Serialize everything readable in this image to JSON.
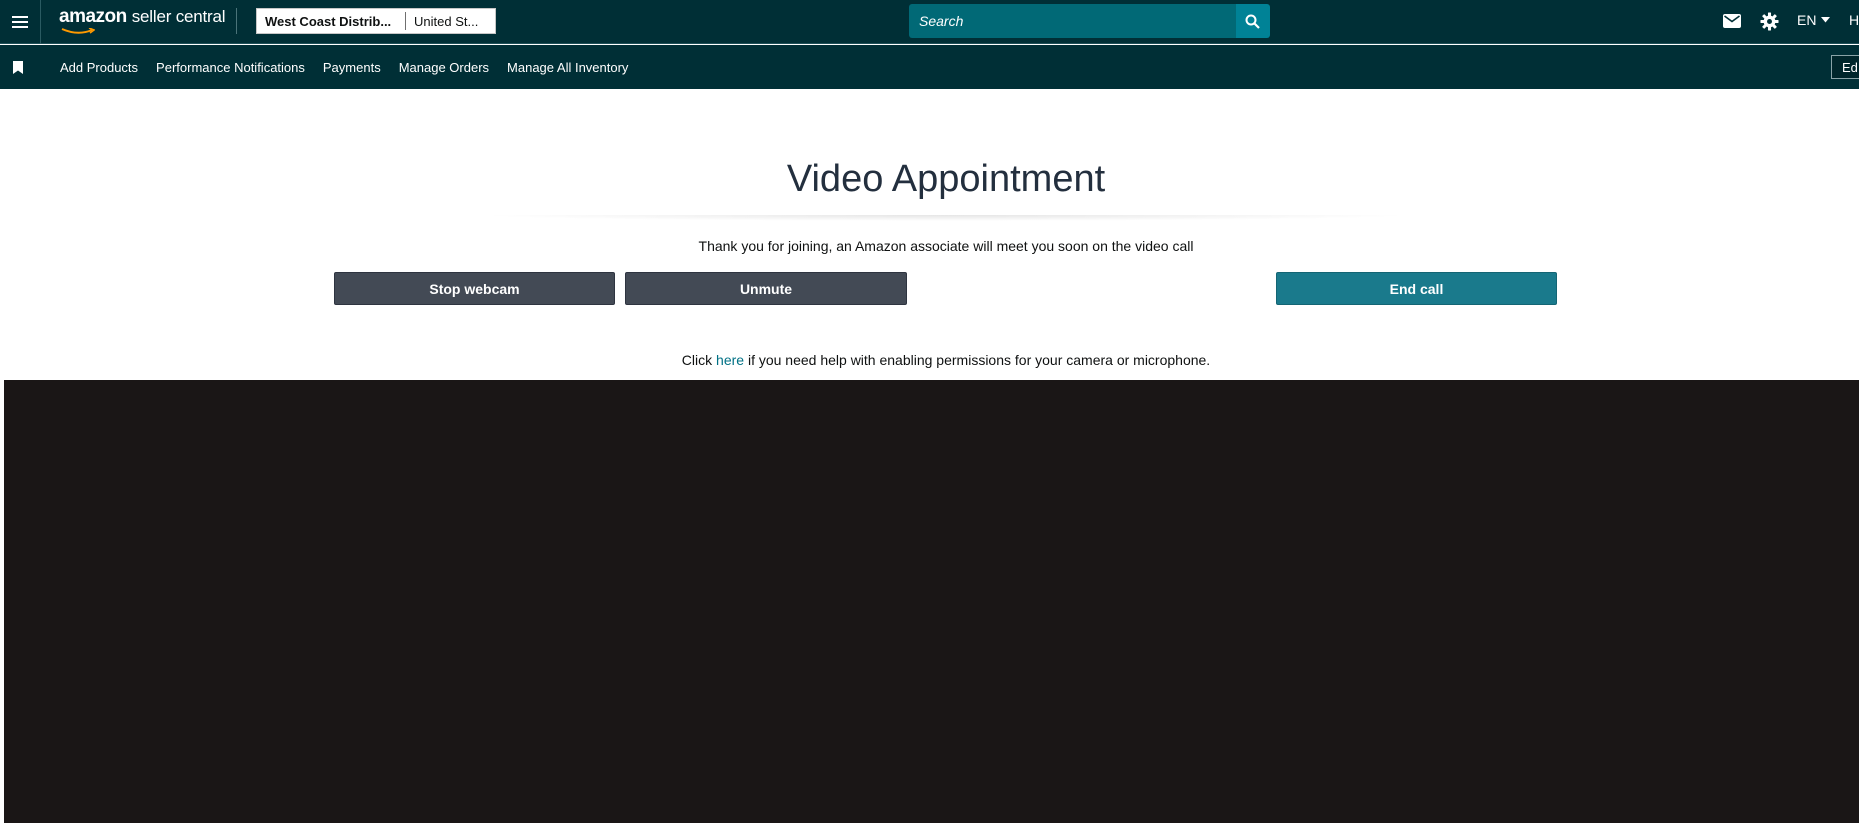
{
  "header": {
    "logo_amazon": "amazon",
    "logo_seller_central": "seller central",
    "account_name": "West Coast Distrib...",
    "marketplace": "United St...",
    "search_placeholder": "Search",
    "language": "EN",
    "help_truncated": "H"
  },
  "nav": {
    "items": [
      "Add Products",
      "Performance Notifications",
      "Payments",
      "Manage Orders",
      "Manage All Inventory"
    ],
    "edit_label": "Ed"
  },
  "main": {
    "title": "Video Appointment",
    "subtitle": "Thank you for joining, an Amazon associate will meet you soon on the video call",
    "stop_webcam_label": "Stop webcam",
    "unmute_label": "Unmute",
    "end_call_label": "End call",
    "help_prefix": "Click ",
    "help_link": "here",
    "help_suffix": " if you need help with enabling permissions for your camera or microphone."
  },
  "colors": {
    "header_bg": "#002f36",
    "search_bg": "#016976",
    "search_button": "#008296",
    "dark_button": "#434a55",
    "end_call_button": "#1a7a8c",
    "video_bg": "#1a1616",
    "link": "#007185"
  },
  "icons": [
    "menu-icon",
    "smile-arrow-icon",
    "search-icon",
    "mail-icon",
    "gear-icon",
    "chevron-down-icon",
    "bookmark-icon"
  ]
}
